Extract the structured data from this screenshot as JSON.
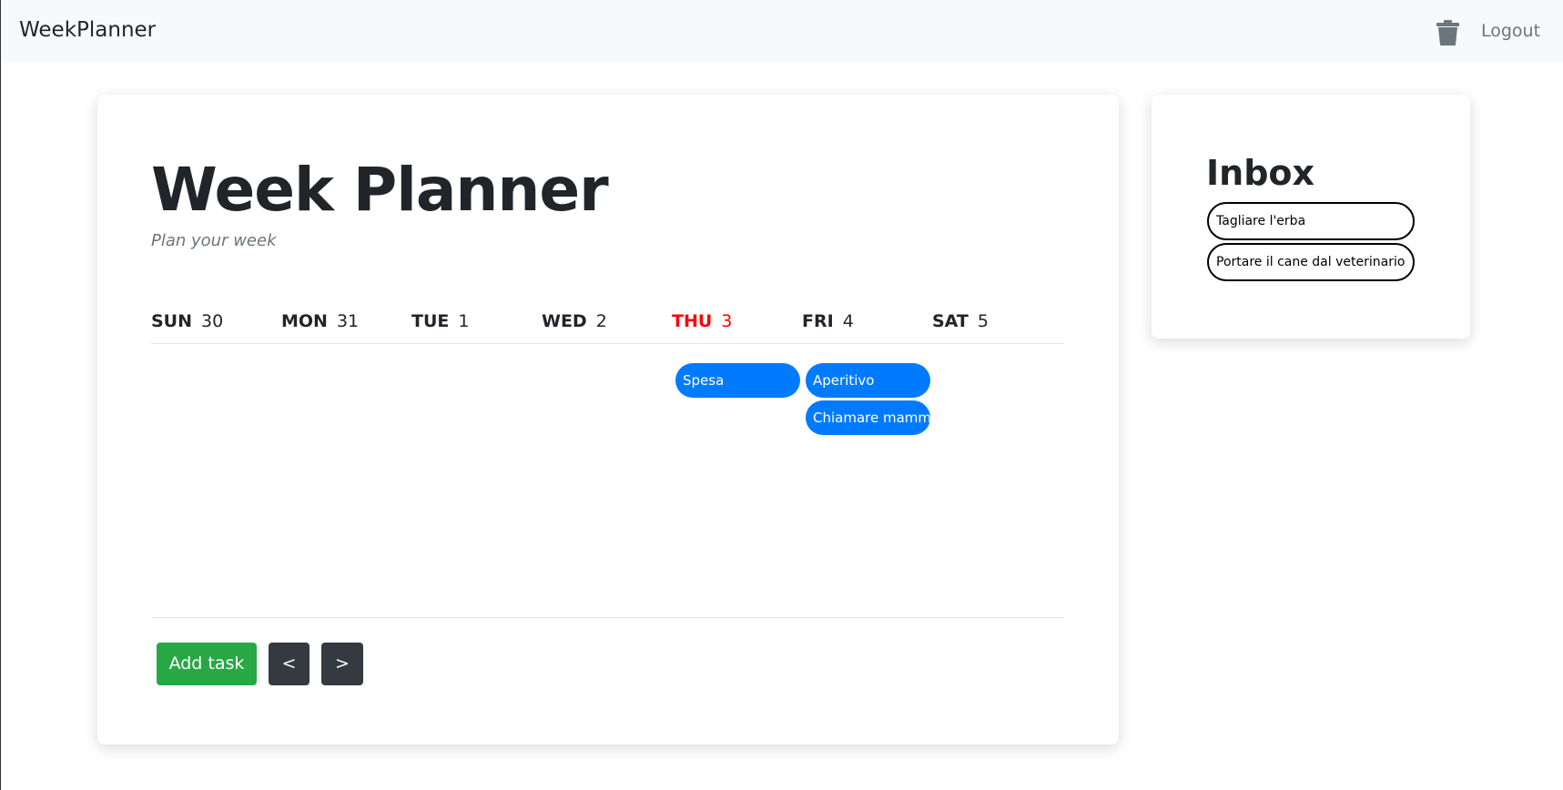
{
  "navbar": {
    "brand": "WeekPlanner",
    "trash_icon": "trash-icon",
    "logout_label": "Logout"
  },
  "planner": {
    "title": "Week Planner",
    "subtitle": "Plan your week",
    "days": [
      {
        "name": "SUN",
        "date": "30"
      },
      {
        "name": "MON",
        "date": "31"
      },
      {
        "name": "TUE",
        "date": "1"
      },
      {
        "name": "WED",
        "date": "2"
      },
      {
        "name": "THU",
        "date": "3",
        "today": true
      },
      {
        "name": "FRI",
        "date": "4"
      },
      {
        "name": "SAT",
        "date": "5"
      }
    ],
    "tasks": {
      "thu": [
        "Spesa"
      ],
      "fri": [
        "Aperitivo",
        "Chiamare mamma"
      ]
    },
    "buttons": {
      "add": "Add task",
      "prev": "<",
      "next": ">"
    }
  },
  "inbox": {
    "title": "Inbox",
    "items": [
      "Tagliare l'erba",
      "Portare il cane dal veterinario"
    ]
  },
  "colors": {
    "task": "#007bff",
    "add": "#28a745",
    "nav_button": "#343a40",
    "today": "#ff0000"
  }
}
